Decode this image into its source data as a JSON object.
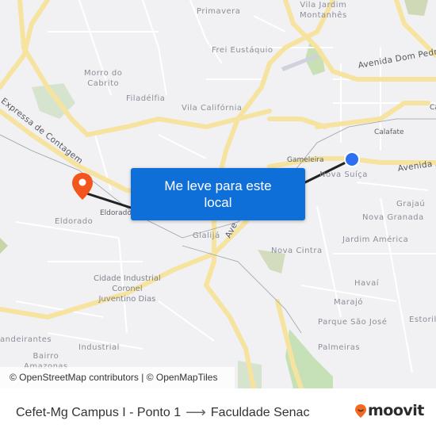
{
  "map": {
    "neighborhoods": [
      {
        "id": "primavera",
        "label": "Primavera"
      },
      {
        "id": "vila-jardim-montanhes",
        "label": "Vila Jardim\nMontanhês"
      },
      {
        "id": "frei-eustaquio",
        "label": "Frei Eustáquio"
      },
      {
        "id": "morro-do-cabrito",
        "label": "Morro do\nCabrito"
      },
      {
        "id": "filadelfia",
        "label": "Filadélfia"
      },
      {
        "id": "vila-california",
        "label": "Vila Califórnia"
      },
      {
        "id": "nova-suica",
        "label": "Nova Suíça"
      },
      {
        "id": "grajau",
        "label": "Grajaú"
      },
      {
        "id": "nova-granada",
        "label": "Nova Granada"
      },
      {
        "id": "jardim-america",
        "label": "Jardim América"
      },
      {
        "id": "nova-cintra",
        "label": "Nova Cintra"
      },
      {
        "id": "eldorado",
        "label": "Eldorado"
      },
      {
        "id": "glalija",
        "label": "Glalijá"
      },
      {
        "id": "cidade-industrial",
        "label": "Cidade Industrial\nCoronel\nJuventino Dias"
      },
      {
        "id": "havai",
        "label": "Havaí"
      },
      {
        "id": "marajo",
        "label": "Marajó"
      },
      {
        "id": "parque-sao-jose",
        "label": "Parque São José"
      },
      {
        "id": "estoril",
        "label": "Estoril"
      },
      {
        "id": "palmeiras",
        "label": "Palmeiras"
      },
      {
        "id": "bandeirantes",
        "label": "andeirantes"
      },
      {
        "id": "industrial",
        "label": "Industrial"
      },
      {
        "id": "bairro-amazonas",
        "label": "Bairro\nAmazonas"
      }
    ],
    "stations": [
      {
        "id": "gameleira",
        "label": "Gameleira"
      },
      {
        "id": "calafate",
        "label": "Calafate"
      },
      {
        "id": "eldorado-station",
        "label": "Eldorado"
      },
      {
        "id": "ca",
        "label": "Ca"
      }
    ],
    "roads": [
      {
        "id": "avenida-dom-pedro",
        "label": "Avenida Dom Pedro"
      },
      {
        "id": "avenida-a",
        "label": "Avenida A"
      },
      {
        "id": "expressa-de-contagem",
        "label": "Expressa de Contagem"
      },
      {
        "id": "ave",
        "label": "Ave"
      }
    ],
    "origin_marker": {
      "name": "Cefet-Mg Campus I - Ponto 1",
      "color": "#2e6ff2"
    },
    "destination_marker": {
      "name": "Faculdade Senac",
      "color": "#f2561d"
    },
    "cta_label": "Me leve para este local",
    "attribution": "© OpenStreetMap contributors | © OpenMapTiles"
  },
  "footer": {
    "origin": "Cefet-Mg Campus I - Ponto 1",
    "arrow": "⟶",
    "destination": "Faculdade Senac",
    "logo_text": "moovit",
    "logo_color": "#f26a21"
  }
}
